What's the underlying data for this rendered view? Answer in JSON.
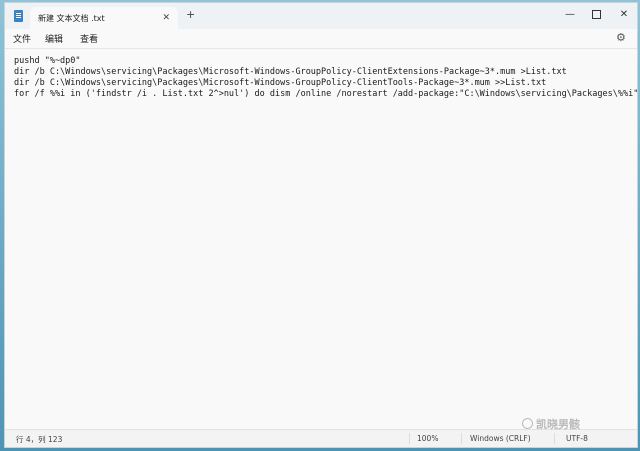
{
  "window": {
    "tab_title": "新建 文本文档 .txt",
    "tab_close": "✕",
    "new_tab": "+",
    "controls": {
      "minimize": "—",
      "close": "✕"
    }
  },
  "menu": {
    "file": "文件",
    "edit": "编辑",
    "view": "查看",
    "settings_icon": "⚙"
  },
  "editor": {
    "lines": [
      "pushd \"%~dp0\"",
      "dir /b C:\\Windows\\servicing\\Packages\\Microsoft-Windows-GroupPolicy-ClientExtensions-Package~3*.mum >List.txt",
      "dir /b C:\\Windows\\servicing\\Packages\\Microsoft-Windows-GroupPolicy-ClientTools-Package~3*.mum >>List.txt",
      "for /f %%i in ('findstr /i . List.txt 2^>nul') do dism /online /norestart /add-package:\"C:\\Windows\\servicing\\Packages\\%%i\""
    ]
  },
  "status": {
    "position": "行 4，列 123",
    "zoom": "100%",
    "line_ending": "Windows (CRLF)",
    "encoding": "UTF-8"
  },
  "watermark": "凯晓男骸"
}
